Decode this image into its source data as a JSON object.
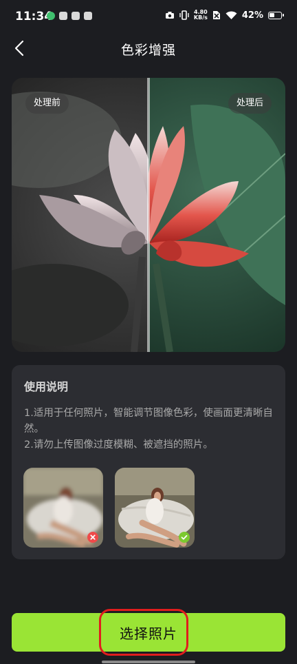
{
  "status_bar": {
    "time": "11:34",
    "net_speed_value": "4.80",
    "net_speed_unit": "KB/s",
    "battery": "42%"
  },
  "header": {
    "title": "色彩增强"
  },
  "comparison": {
    "before_label": "处理前",
    "after_label": "处理后"
  },
  "guide": {
    "title": "使用说明",
    "lines": [
      "1.适用于任何照片，智能调节图像色彩，使画面更清晰自然。",
      "2.请勿上传图像过度模糊、被遮挡的照片。"
    ],
    "examples": [
      {
        "status": "bad",
        "icon": "x-icon",
        "color": "#ef4a4a"
      },
      {
        "status": "good",
        "icon": "check-icon",
        "color": "#7cc92f"
      }
    ]
  },
  "action": {
    "select_label": "选择照片"
  },
  "colors": {
    "accent": "#9ae435",
    "background": "#1c1d21",
    "card": "#2c2d32",
    "highlight": "#e11d1d"
  }
}
